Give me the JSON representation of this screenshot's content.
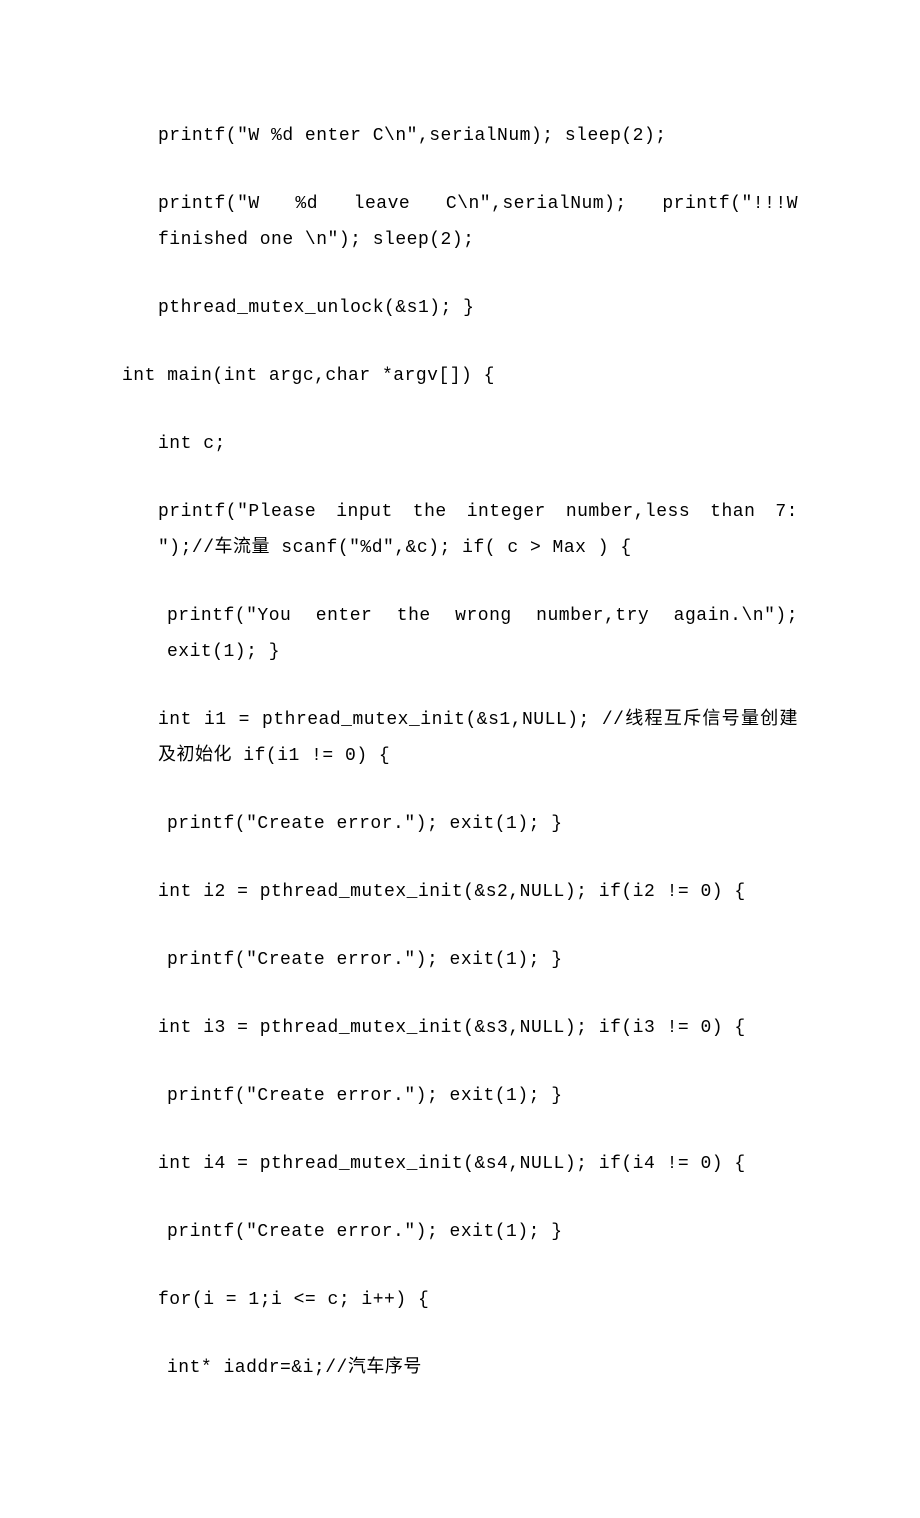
{
  "p1": "printf(\"W %d enter C\\n\",serialNum);   sleep(2);",
  "p2": "printf(\"W %d leave C\\n\",serialNum);   printf(\"!!!W finished one \\n\");   sleep(2);",
  "p3": "pthread_mutex_unlock(&s1); }",
  "p4": "int main(int argc,char *argv[]) {",
  "p5": "int c;",
  "p6": "printf(\"Please input the integer number,less than 7: \");//车流量   scanf(\"%d\",&c);   if( c > Max )    {",
  "p7": "printf(\"You   enter   the   wrong   number,try   again.\\n\");     exit(1);   }",
  "p8": "int i1 = pthread_mutex_init(&s1,NULL); //线程互斥信号量创建及初始化   if(i1 != 0)   {",
  "p9": "printf(\"Create error.\");     exit(1);   }",
  "p10": "int i2 = pthread_mutex_init(&s2,NULL);   if(i2 != 0)   {",
  "p11": "printf(\"Create error.\");     exit(1);   }",
  "p12": "int i3 = pthread_mutex_init(&s3,NULL);   if(i3 != 0)   {",
  "p13": "printf(\"Create error.\");     exit(1);   }",
  "p14": "int i4 = pthread_mutex_init(&s4,NULL);   if(i4 != 0)   {",
  "p15": "printf(\"Create error.\");     exit(1);   }",
  "p16": "for(i = 1;i <= c; i++)   {",
  "p17": "int* iaddr=&i;//汽车序号"
}
